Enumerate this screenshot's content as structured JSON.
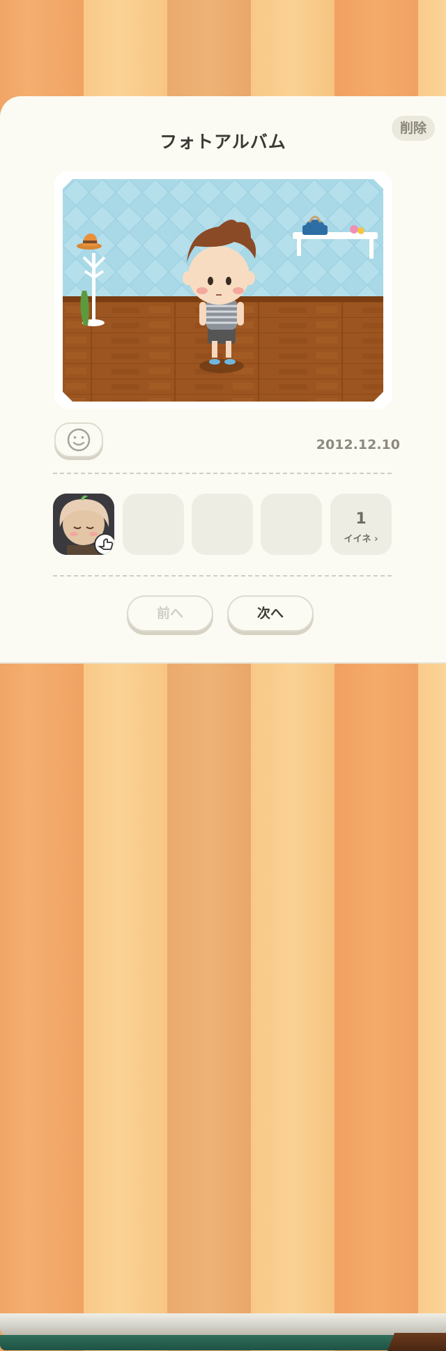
{
  "header": {
    "title": "フォトアルバム",
    "delete_label": "削除"
  },
  "photo": {
    "scene": "room with avatar"
  },
  "reaction": {
    "icon": "smile-face-icon",
    "date": "2012.12.10"
  },
  "likes": {
    "count": "1",
    "label": "イイネ ›"
  },
  "navigation": {
    "prev_label": "前へ",
    "next_label": "次へ"
  },
  "colors": {
    "card_bg": "#fcfbf3",
    "wall": "#a9d9e7",
    "floor": "#9a521c",
    "cover_green": "#2f6e5a"
  }
}
